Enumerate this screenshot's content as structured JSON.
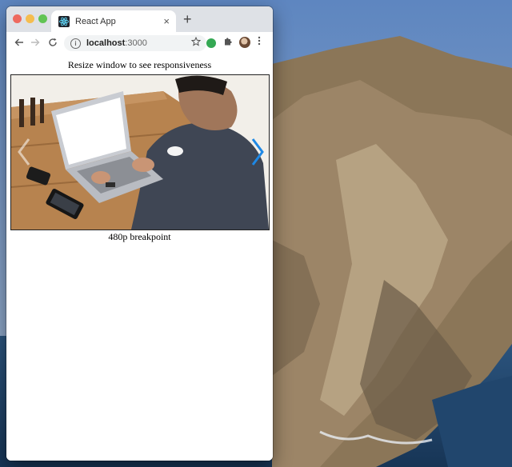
{
  "browser": {
    "tab_title": "React App",
    "tab_close": "×",
    "new_tab": "+",
    "url_host": "localhost",
    "url_port": ":3000",
    "info_icon": "i"
  },
  "icons": {
    "back": "back-arrow-icon",
    "forward": "forward-arrow-icon",
    "reload": "reload-icon",
    "star": "star-icon",
    "extension": "puzzle-icon",
    "menu": "kebab-menu-icon"
  },
  "page": {
    "heading": "Resize window to see responsiveness",
    "caption": "480p breakpoint"
  },
  "carousel": {
    "arrow_color": "#1e88e5"
  }
}
